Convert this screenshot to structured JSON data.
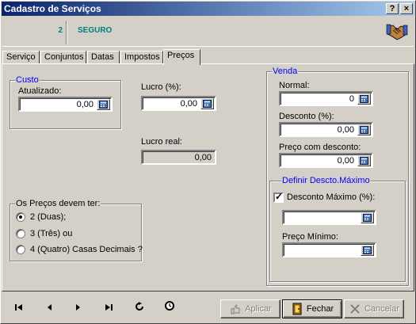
{
  "window": {
    "title": "Cadastro de Serviços",
    "help": "?",
    "close": "×"
  },
  "header": {
    "number": "2",
    "name": "SEGURO"
  },
  "tabs": [
    {
      "label": "Serviço"
    },
    {
      "label": "Conjuntos"
    },
    {
      "label": "Datas"
    },
    {
      "label": "Impostos"
    },
    {
      "label": "Preços"
    }
  ],
  "custo": {
    "title": "Custo",
    "atualizado_label": "Atualizado:",
    "atualizado_value": "0,00"
  },
  "lucro": {
    "label": "Lucro (%):",
    "value": "0,00"
  },
  "lucro_real": {
    "label": "Lucro real:",
    "value": "0,00"
  },
  "precos": {
    "title": "Os Preços devem ter:",
    "options": [
      "2 (Duas);",
      "3 (Três) ou",
      "4 (Quatro) Casas Decimais ?"
    ],
    "selected": 0
  },
  "venda": {
    "title": "Venda",
    "normal_label": "Normal:",
    "normal_value": "0",
    "desconto_label": "Desconto (%):",
    "desconto_value": "0,00",
    "preco_desc_label": "Preço com desconto:",
    "preco_desc_value": "0,00"
  },
  "desc_max": {
    "title": "Definir Descto.Máximo",
    "check_label": "Desconto Máximo (%):",
    "checked": true,
    "check_value": "",
    "preco_min_label": "Preço Mínimo:",
    "preco_min_value": ""
  },
  "buttons": {
    "aplicar": "Aplicar",
    "fechar": "Fechar",
    "cancelar": "Cancelar"
  },
  "nav_icons": [
    "first-record-icon",
    "previous-record-icon",
    "next-record-icon",
    "last-record-icon",
    "refresh-icon",
    "history-icon"
  ],
  "colors": {
    "title_start": "#0a246a",
    "title_end": "#a6caf0",
    "group_title": "#0000ff",
    "header_text": "#008080"
  }
}
